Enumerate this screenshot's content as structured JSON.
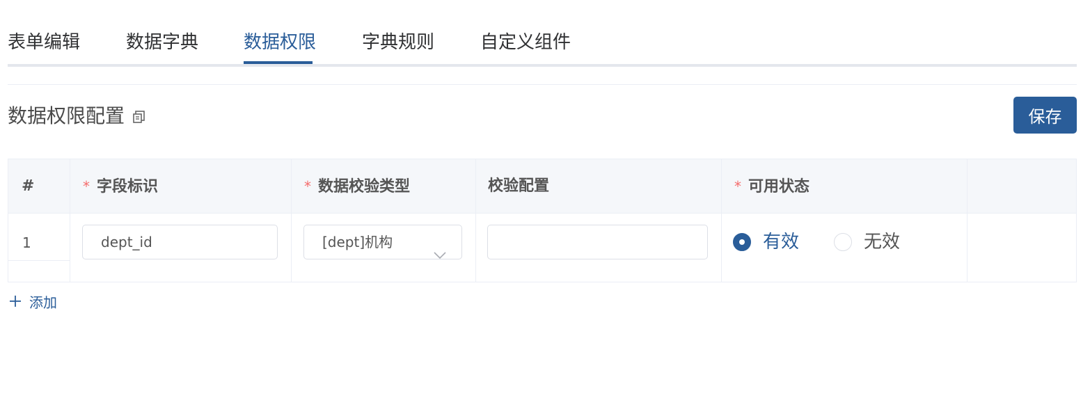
{
  "tabs": [
    {
      "label": "表单编辑",
      "active": false
    },
    {
      "label": "数据字典",
      "active": false
    },
    {
      "label": "数据权限",
      "active": true
    },
    {
      "label": "字典规则",
      "active": false
    },
    {
      "label": "自定义组件",
      "active": false
    }
  ],
  "section": {
    "title": "数据权限配置",
    "title_icon": "copy-icon",
    "save_label": "保存"
  },
  "table": {
    "headers": {
      "index": "#",
      "field_id": "字段标识",
      "validation_type": "数据校验类型",
      "validation_config": "校验配置",
      "status": "可用状态",
      "required_mark": "*"
    },
    "rows": [
      {
        "index": "1",
        "field_id": "dept_id",
        "validation_type": "[dept]机构",
        "validation_config": "",
        "status_options": [
          "有效",
          "无效"
        ],
        "status_selected": "有效"
      }
    ]
  },
  "add_label": "添加",
  "colors": {
    "primary": "#2a5d99",
    "required": "#f56c6c",
    "header_bg": "#f5f7fa",
    "border": "#ebeef5"
  }
}
